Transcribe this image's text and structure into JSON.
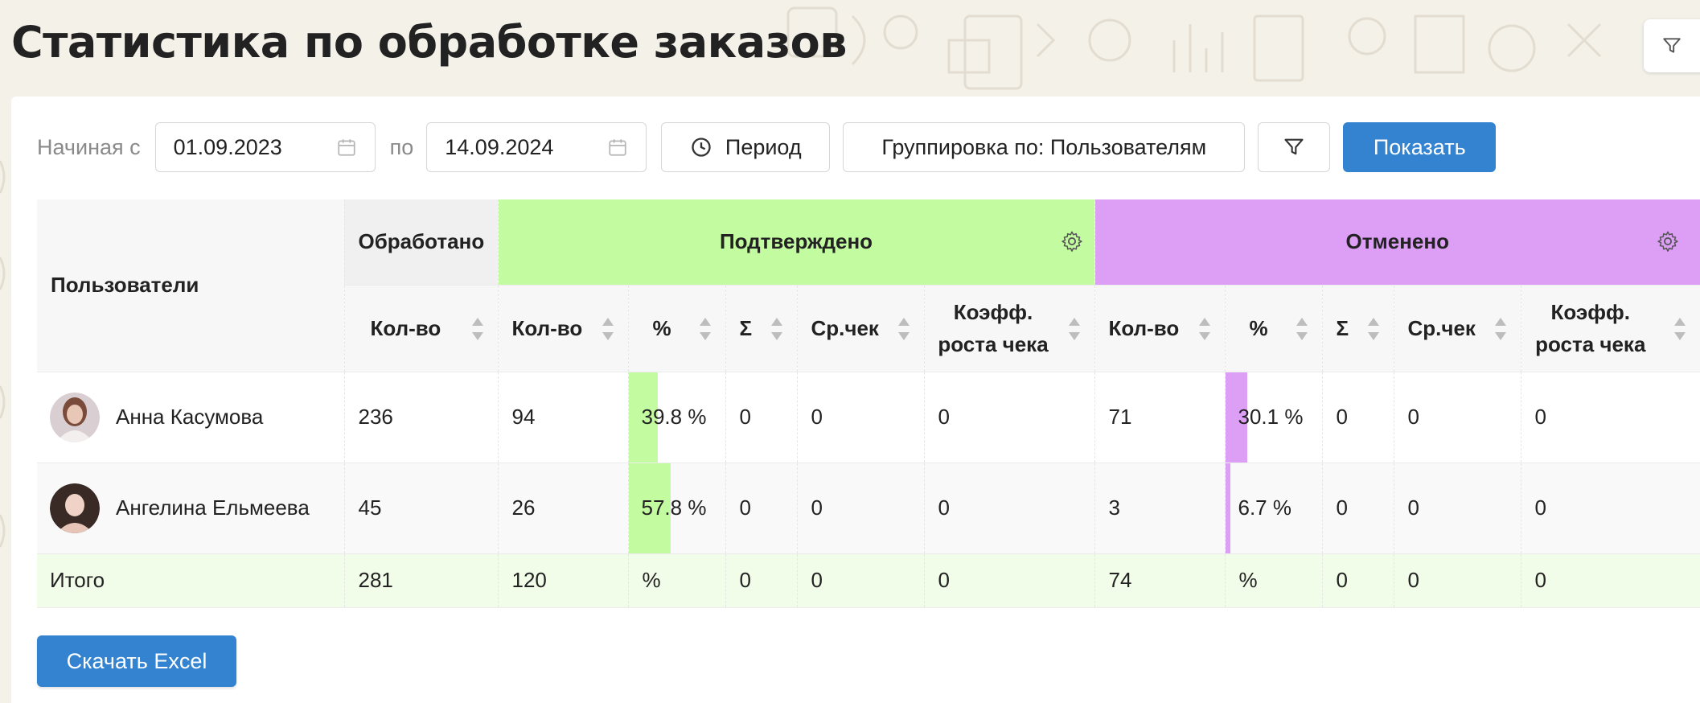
{
  "header": {
    "title": "Статистика по обработке заказов"
  },
  "toolbar": {
    "from_label": "Начиная с",
    "date_from": "01.09.2023",
    "to_label": "по",
    "date_to": "14.09.2024",
    "period_label": "Период",
    "grouping_label": "Группировка по: Пользователям",
    "show_label": "Показать"
  },
  "table": {
    "headers": {
      "users": "Пользователи",
      "processed": "Обработано",
      "confirmed": "Подтверждено",
      "cancelled": "Отменено"
    },
    "subheaders": {
      "qty": "Кол-во",
      "pct": "%",
      "sum": "Σ",
      "avg": "Ср.чек",
      "growth_line1": "Коэфф.",
      "growth_line2": "роста чека"
    },
    "rows": [
      {
        "name": "Анна Касумова",
        "processed": "236",
        "conf_qty": "94",
        "conf_pct": "39.8 %",
        "conf_pct_value": 39.8,
        "conf_sum": "0",
        "conf_avg": "0",
        "conf_growth": "0",
        "canc_qty": "71",
        "canc_pct": "30.1 %",
        "canc_pct_value": 30.1,
        "canc_sum": "0",
        "canc_avg": "0",
        "canc_growth": "0"
      },
      {
        "name": "Ангелина Ельмеева",
        "processed": "45",
        "conf_qty": "26",
        "conf_pct": "57.8 %",
        "conf_pct_value": 57.8,
        "conf_sum": "0",
        "conf_avg": "0",
        "conf_growth": "0",
        "canc_qty": "3",
        "canc_pct": "6.7 %",
        "canc_pct_value": 6.7,
        "canc_sum": "0",
        "canc_avg": "0",
        "canc_growth": "0"
      }
    ],
    "total": {
      "label": "Итого",
      "processed": "281",
      "conf_qty": "120",
      "conf_pct": "%",
      "conf_sum": "0",
      "conf_avg": "0",
      "conf_growth": "0",
      "canc_qty": "74",
      "canc_pct": "%",
      "canc_sum": "0",
      "canc_avg": "0",
      "canc_growth": "0"
    }
  },
  "footer": {
    "excel_label": "Скачать Excel"
  },
  "colors": {
    "confirmed": "#c3fba0",
    "cancelled": "#dd9ef6",
    "primary": "#3383d0"
  },
  "icons": [
    "calendar-icon",
    "clock-period-icon",
    "filter-icon",
    "gear-icon",
    "sort-icon"
  ]
}
